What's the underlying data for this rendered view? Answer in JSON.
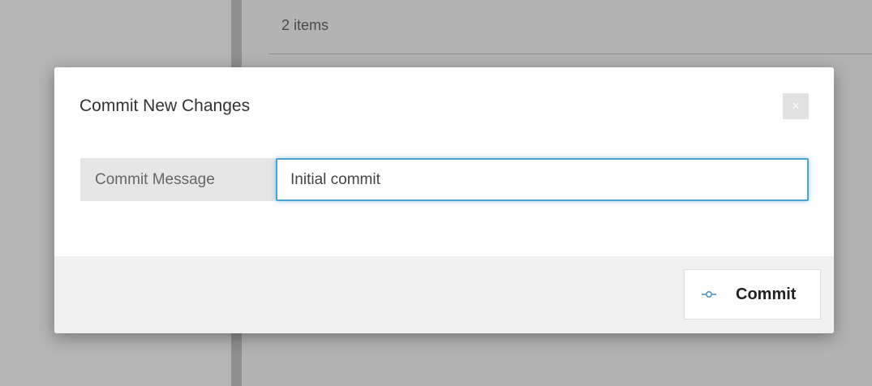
{
  "background": {
    "item_count": "2 items"
  },
  "modal": {
    "title": "Commit New Changes",
    "close_symbol": "×",
    "field": {
      "label": "Commit Message",
      "value": "Initial commit"
    },
    "commit_button": {
      "icon": "git-commit-icon",
      "label": "Commit"
    }
  },
  "colors": {
    "input_focus_border": "#4aa3d8",
    "commit_icon": "#4a90c8"
  }
}
